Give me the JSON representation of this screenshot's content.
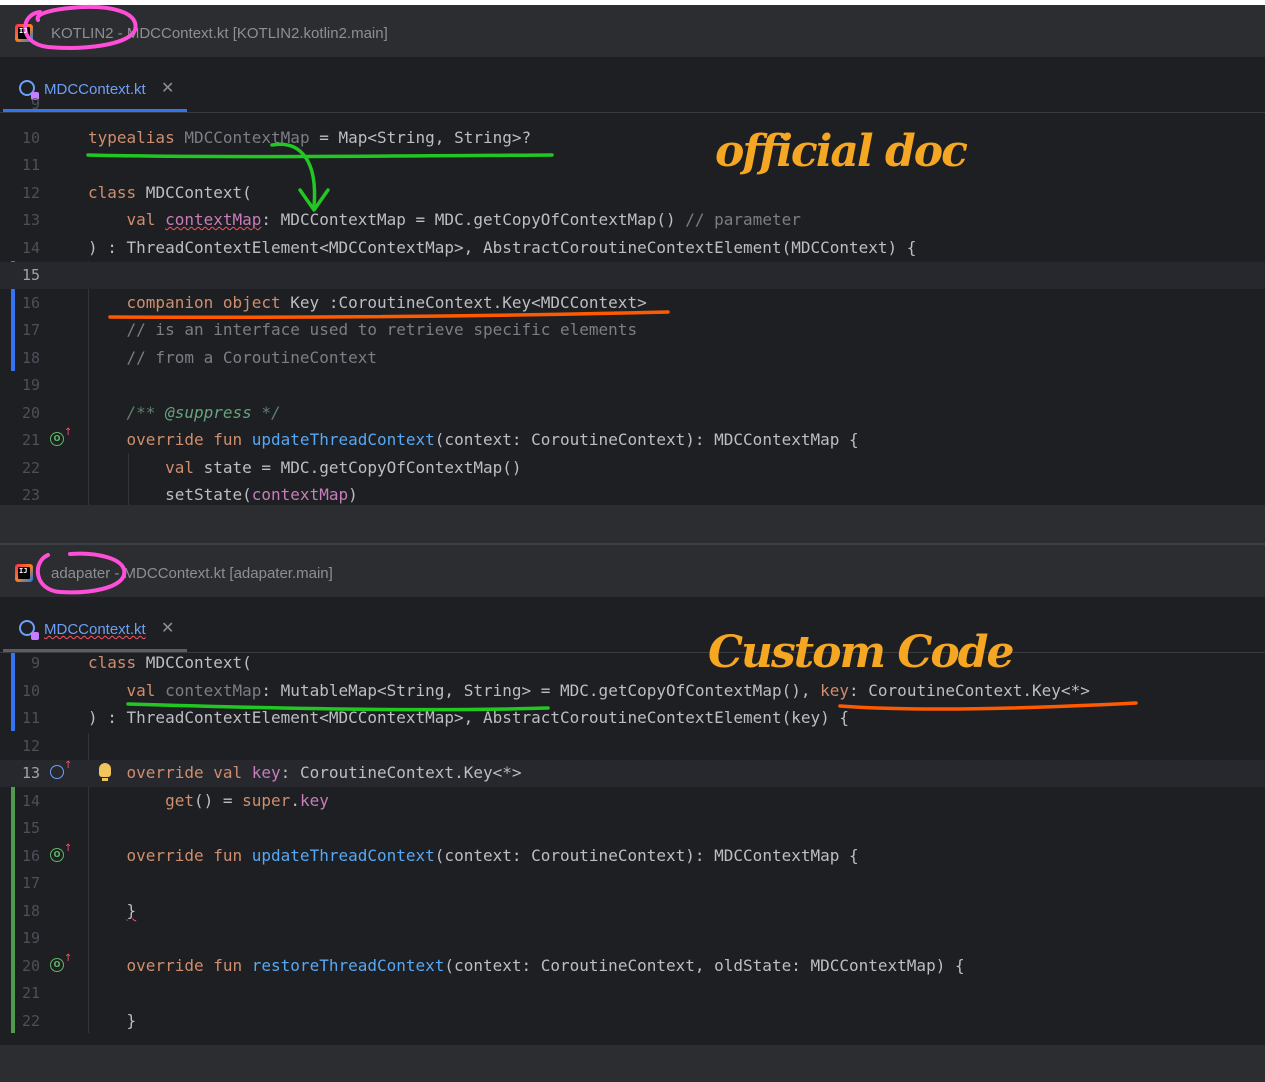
{
  "top_window": {
    "title": "KOTLIN2 - MDCContext.kt [KOTLIN2.kotlin2.main]",
    "tab_label": "MDCContext.kt",
    "lines": [
      {
        "n": "9",
        "code": ""
      },
      {
        "n": "10",
        "code": "typealias MDCContextMap = Map<String, String>?"
      },
      {
        "n": "11",
        "code": ""
      },
      {
        "n": "12",
        "code": "class MDCContext("
      },
      {
        "n": "13",
        "code": "    val contextMap: MDCContextMap = MDC.getCopyOfContextMap() // parameter"
      },
      {
        "n": "14",
        "code": ") : ThreadContextElement<MDCContextMap>, AbstractCoroutineContextElement(MDCContext) {"
      },
      {
        "n": "15",
        "code": ""
      },
      {
        "n": "16",
        "code": "    companion object Key :CoroutineContext.Key<MDCContext>"
      },
      {
        "n": "17",
        "code": "    // is an interface used to retrieve specific elements"
      },
      {
        "n": "18",
        "code": "    // from a CoroutineContext"
      },
      {
        "n": "19",
        "code": ""
      },
      {
        "n": "20",
        "code": "    /** @suppress */"
      },
      {
        "n": "21",
        "code": "    override fun updateThreadContext(context: CoroutineContext): MDCContextMap {"
      },
      {
        "n": "22",
        "code": "        val state = MDC.getCopyOfContextMap()"
      },
      {
        "n": "23",
        "code": "        setState(contextMap)"
      }
    ]
  },
  "bottom_window": {
    "title": "adapater - MDCContext.kt [adapater.main]",
    "tab_label": "MDCContext.kt",
    "lines": [
      {
        "n": "9",
        "code": "class MDCContext("
      },
      {
        "n": "10",
        "code": "    val contextMap: MutableMap<String, String> = MDC.getCopyOfContextMap(), key: CoroutineContext.Key<*>"
      },
      {
        "n": "11",
        "code": ") : ThreadContextElement<MDCContextMap>, AbstractCoroutineContextElement(key) {"
      },
      {
        "n": "12",
        "code": ""
      },
      {
        "n": "13",
        "code": "    override val key: CoroutineContext.Key<*>"
      },
      {
        "n": "14",
        "code": "        get() = super.key"
      },
      {
        "n": "15",
        "code": ""
      },
      {
        "n": "16",
        "code": "    override fun updateThreadContext(context: CoroutineContext): MDCContextMap {"
      },
      {
        "n": "17",
        "code": ""
      },
      {
        "n": "18",
        "code": "    }"
      },
      {
        "n": "19",
        "code": ""
      },
      {
        "n": "20",
        "code": "    override fun restoreThreadContext(context: CoroutineContext, oldState: MDCContextMap) {"
      },
      {
        "n": "21",
        "code": ""
      },
      {
        "n": "22",
        "code": "    }"
      }
    ]
  },
  "annotations": {
    "official": "official doc",
    "custom": "Custom Code"
  },
  "colors": {
    "editor_bg": "#1e1f22",
    "keyword": "#cf8e6d",
    "function": "#56a8f5",
    "property": "#c77dba",
    "comment": "#7a7e85",
    "annotation_orange": "#f5a623",
    "mark_green": "#22c822",
    "mark_red": "#ff5a00",
    "mark_pink": "#ff4fd8"
  }
}
